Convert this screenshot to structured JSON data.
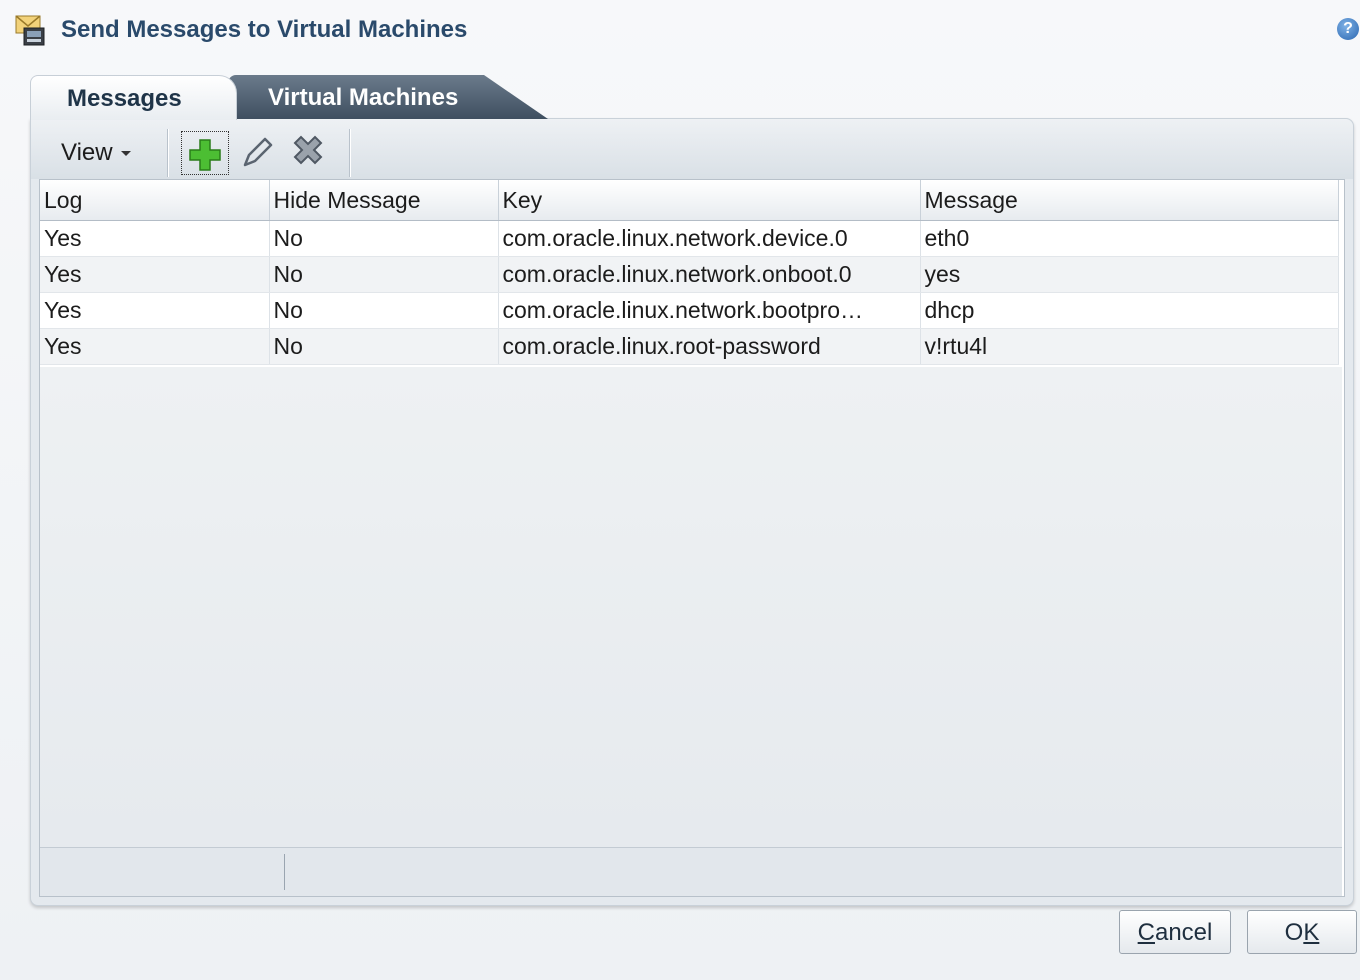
{
  "dialog": {
    "title": "Send Messages to Virtual Machines",
    "help_icon": "help-icon"
  },
  "tabs": [
    {
      "label": "Messages",
      "active": true
    },
    {
      "label": "Virtual Machines",
      "active": false
    }
  ],
  "toolbar": {
    "view_label": "View",
    "icons": [
      "add-icon",
      "edit-icon",
      "delete-icon"
    ]
  },
  "table": {
    "columns": [
      "Log",
      "Hide Message",
      "Key",
      "Message"
    ],
    "rows": [
      {
        "log": "Yes",
        "hide": "No",
        "key": "com.oracle.linux.network.device.0",
        "message": "eth0"
      },
      {
        "log": "Yes",
        "hide": "No",
        "key": "com.oracle.linux.network.onboot.0",
        "message": "yes"
      },
      {
        "log": "Yes",
        "hide": "No",
        "key": "com.oracle.linux.network.bootpro…",
        "message": "dhcp"
      },
      {
        "log": "Yes",
        "hide": "No",
        "key": "com.oracle.linux.root-password",
        "message": "v!rtu4l"
      }
    ]
  },
  "buttons": {
    "cancel_first": "C",
    "cancel_rest": "ancel",
    "ok_first": "O",
    "ok_rest": "K"
  },
  "colors": {
    "title": "#2a4a6b",
    "tab_inactive": "#4a5a6b",
    "add_green": "#3fae2a"
  }
}
